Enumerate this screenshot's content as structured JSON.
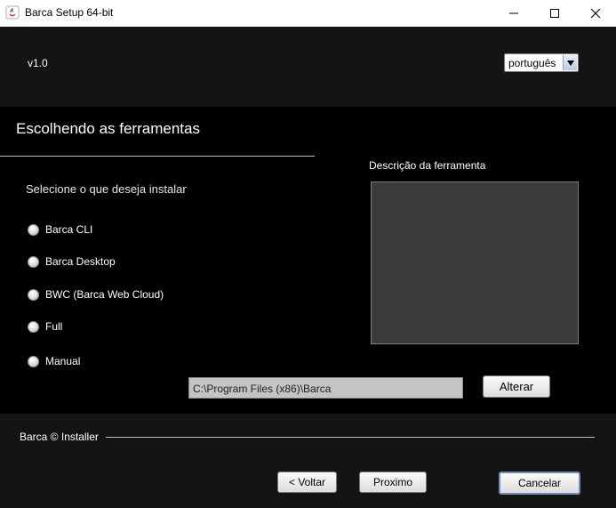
{
  "window": {
    "title": "Barca Setup 64-bit"
  },
  "header": {
    "version": "v1.0",
    "language_selected": "português"
  },
  "main": {
    "section_title": "Escolhendo as ferramentas",
    "select_prompt": "Selecione o que deseja instalar",
    "options": [
      {
        "label": "Barca CLI",
        "selected": false
      },
      {
        "label": "Barca Desktop",
        "selected": false
      },
      {
        "label": "BWC (Barca Web Cloud)",
        "selected": false
      },
      {
        "label": "Full",
        "selected": false
      },
      {
        "label": "Manual",
        "selected": false
      }
    ],
    "description_label": "Descrição da ferramenta",
    "install_path": "C:\\Program Files (x86)\\Barca",
    "change_button": "Alterar"
  },
  "footer": {
    "label": "Barca © Installer",
    "back_button": "< Voltar",
    "next_button": "Proximo",
    "cancel_button": "Cancelar"
  },
  "colors": {
    "background": "#000000",
    "header_band": "#141414",
    "description_box": "#3b3b3b",
    "focus_border": "#6f8fb8"
  }
}
